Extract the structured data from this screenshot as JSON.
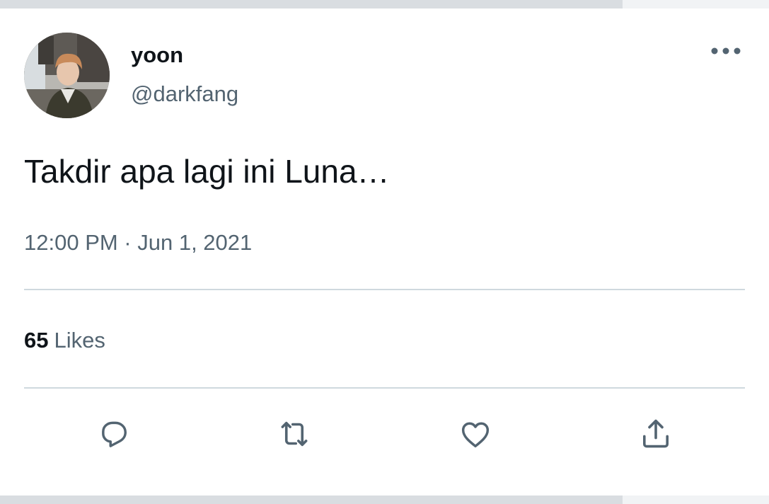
{
  "tweet": {
    "author": {
      "display_name": "yoon",
      "handle": "@darkfang",
      "avatar_icon": "profile-photo"
    },
    "text": "Takdir apa lagi ini Luna…",
    "timestamp": "12:00 PM · Jun 1, 2021",
    "stats": {
      "likes_count": "65",
      "likes_label": "Likes"
    },
    "menu_icon": "more-horizontal-icon",
    "actions": [
      {
        "name": "reply",
        "icon": "reply-icon"
      },
      {
        "name": "retweet",
        "icon": "retweet-icon"
      },
      {
        "name": "like",
        "icon": "heart-icon"
      },
      {
        "name": "share",
        "icon": "share-icon"
      }
    ]
  },
  "colors": {
    "primary_text": "#0f1419",
    "secondary_text": "#536471",
    "divider": "#cfd9de",
    "icon": "#536471",
    "background": "#ffffff"
  }
}
